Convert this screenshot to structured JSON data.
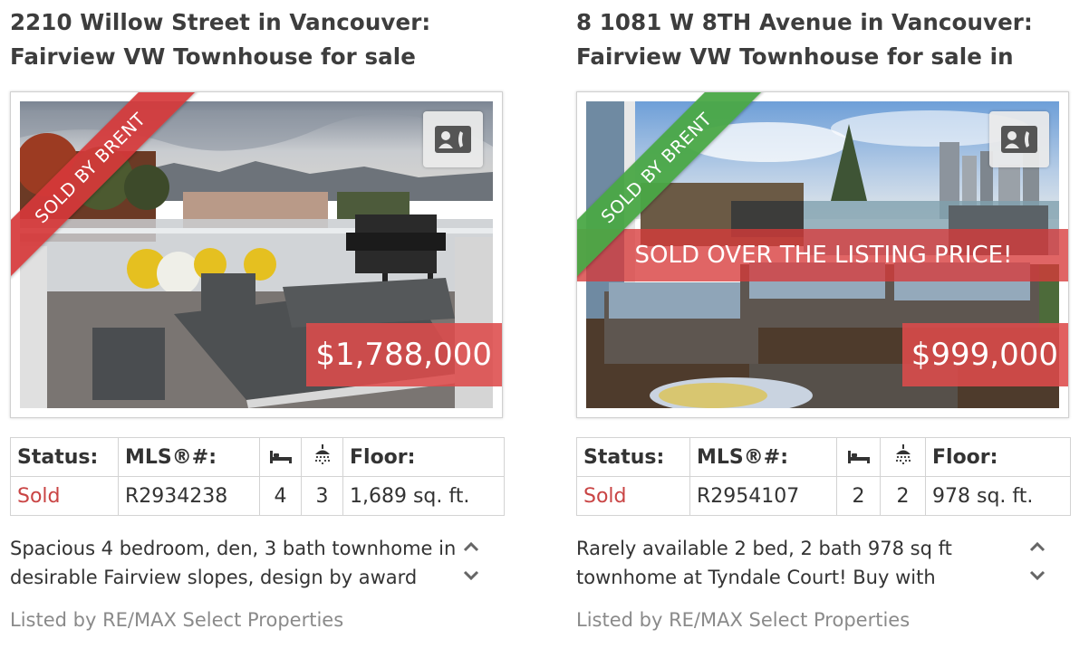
{
  "listings": [
    {
      "title_line1": "2210 Willow Street in Vancouver:",
      "title_line2": "Fairview VW Townhouse for sale",
      "ribbon": "SOLD BY BRENT",
      "ribbon_color": "#d6383a",
      "price": "$1,788,000",
      "banner": "",
      "status_header": "Status:",
      "mls_header": "MLS®#:",
      "floor_header": "Floor:",
      "status": "Sold",
      "mls": "R2934238",
      "beds": "4",
      "baths": "3",
      "floor": "1,689 sq. ft.",
      "desc_line1": "Spacious 4 bedroom, den, 3 bath townhome in",
      "desc_line2": "desirable Fairview slopes, design by award",
      "listed_by": "Listed by RE/MAX Select Properties"
    },
    {
      "title_line1": "8 1081 W 8TH Avenue in Vancouver:",
      "title_line2": "Fairview VW Townhouse for sale in",
      "ribbon": "SOLD BY BRENT",
      "ribbon_color": "#4aa846",
      "price": "$999,000",
      "banner": "SOLD OVER THE LISTING PRICE!",
      "status_header": "Status:",
      "mls_header": "MLS®#:",
      "floor_header": "Floor:",
      "status": "Sold",
      "mls": "R2954107",
      "beds": "2",
      "baths": "2",
      "floor": "978 sq. ft.",
      "desc_line1": "Rarely available 2 bed, 2 bath 978 sq ft",
      "desc_line2": "townhome at Tyndale Court! Buy with",
      "listed_by": "Listed by RE/MAX Select Properties"
    }
  ],
  "icons": {
    "contact": "contact-card-icon",
    "bed": "bed-icon",
    "bath": "shower-icon",
    "up": "chevron-up-icon",
    "down": "chevron-down-icon"
  },
  "colors": {
    "sold_text": "#c94444",
    "price_bg": "#dd4b4b",
    "banner_bg": "#d73a3a"
  }
}
